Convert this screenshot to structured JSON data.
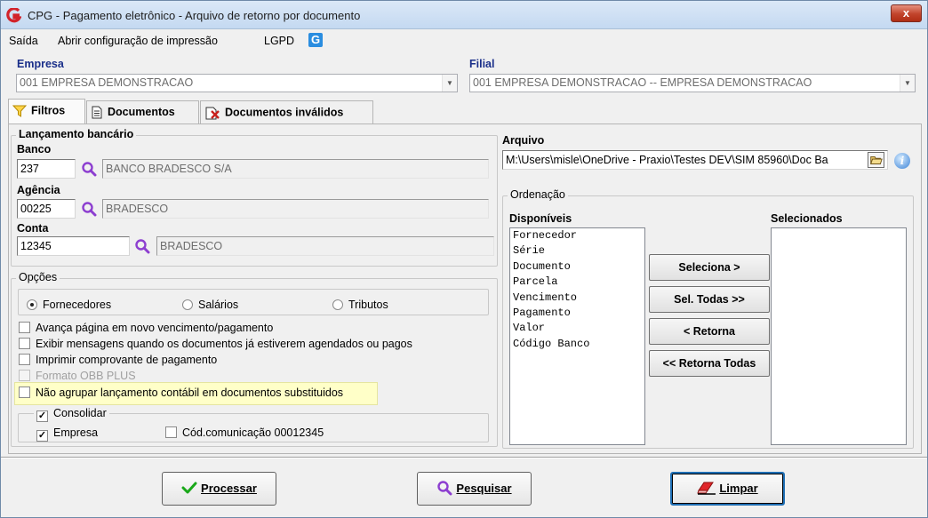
{
  "window": {
    "title": "CPG - Pagamento eletrônico - Arquivo de retorno por documento",
    "close_glyph": "x"
  },
  "menu": {
    "items": [
      "Saída",
      "Abrir configuração de impressão",
      "LGPD"
    ]
  },
  "empresa": {
    "label": "Empresa",
    "value": "001 EMPRESA DEMONSTRACAO"
  },
  "filial": {
    "label": "Filial",
    "value": "001 EMPRESA DEMONSTRACAO -- EMPRESA DEMONSTRACAO"
  },
  "tabs": [
    {
      "label": "Filtros",
      "icon": "funnel-icon"
    },
    {
      "label": "Documentos",
      "icon": "document-icon"
    },
    {
      "label": "Documentos inválidos",
      "icon": "invalid-document-icon"
    }
  ],
  "lancamento": {
    "legend": "Lançamento bancário",
    "banco": {
      "label": "Banco",
      "code": "237",
      "name": "BANCO BRADESCO S/A"
    },
    "agencia": {
      "label": "Agência",
      "code": "00225",
      "name": "BRADESCO"
    },
    "conta": {
      "label": "Conta",
      "code": "12345",
      "name": "BRADESCO"
    }
  },
  "opcoes": {
    "legend": "Opções",
    "radios": [
      {
        "label": "Fornecedores",
        "selected": true
      },
      {
        "label": "Salários",
        "selected": false
      },
      {
        "label": "Tributos",
        "selected": false
      }
    ],
    "checks": [
      {
        "label": "Avança página em novo vencimento/pagamento",
        "checked": false,
        "enabled": true
      },
      {
        "label": "Exibir mensagens quando os documentos já estiverem agendados ou pagos",
        "checked": false,
        "enabled": true
      },
      {
        "label": "Imprimir comprovante de pagamento",
        "checked": false,
        "enabled": true
      },
      {
        "label": "Formato OBB PLUS",
        "checked": false,
        "enabled": false
      },
      {
        "label": "Não agrupar lançamento contábil em documentos substituidos",
        "checked": false,
        "enabled": true
      }
    ],
    "consolidar": {
      "label": "Consolidar",
      "checked": true,
      "empresa": {
        "label": "Empresa",
        "checked": true
      },
      "codigo": {
        "label": "Cód.comunicação 00012345",
        "checked": false
      }
    }
  },
  "arquivo": {
    "label": "Arquivo",
    "path": "M:\\Users\\misle\\OneDrive - Praxio\\Testes DEV\\SIM 85960\\Doc Ba"
  },
  "ordenacao": {
    "legend": "Ordenação",
    "disponiveis_label": "Disponíveis",
    "selecionados_label": "Selecionados",
    "disponiveis": [
      "Fornecedor",
      "Série",
      "Documento",
      "Parcela",
      "Vencimento",
      "Pagamento",
      "Valor",
      "Código Banco"
    ],
    "selecionados": [],
    "buttons": {
      "seleciona": "Seleciona >",
      "sel_todas": "Sel. Todas >>",
      "retorna": "< Retorna",
      "retorna_todas": "<< Retorna Todas"
    }
  },
  "footer": {
    "processar": "Processar",
    "pesquisar": "Pesquisar",
    "limpar": "Limpar"
  },
  "colors": {
    "title_bar": "#c4d9f1",
    "label_blue": "#1a2f8a",
    "highlight": "#ffffc8",
    "lens_purple": "#8d3fd0",
    "check_green": "#1aa81a",
    "close_red": "#c1432b"
  }
}
